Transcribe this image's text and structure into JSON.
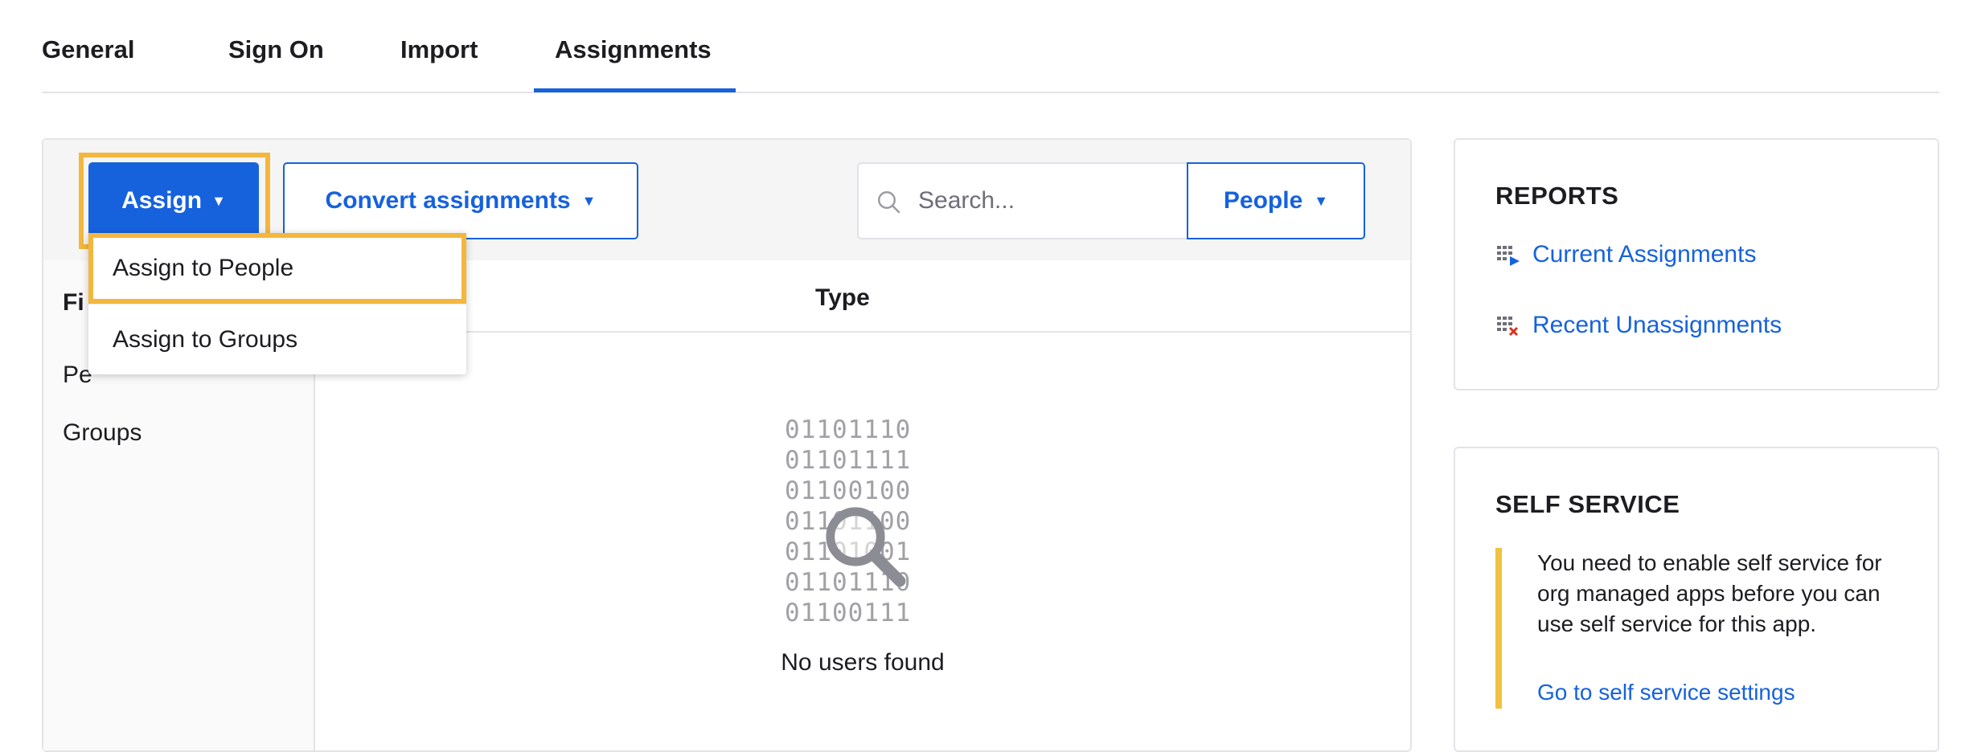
{
  "tabs": [
    {
      "label": "General"
    },
    {
      "label": "Sign On"
    },
    {
      "label": "Import"
    },
    {
      "label": "Assignments",
      "active": true
    }
  ],
  "toolbar": {
    "assign_label": "Assign",
    "convert_label": "Convert assignments",
    "search_placeholder": "Search...",
    "filter_select": "People",
    "caret": "▼"
  },
  "dropdown": {
    "items": [
      "Assign to People",
      "Assign to Groups"
    ]
  },
  "filters": {
    "header": "Fi",
    "items": [
      "Pe",
      "Groups"
    ]
  },
  "table": {
    "type_header": "Type",
    "binary_lines": [
      "01101110",
      "01101111",
      "01100100",
      "01101100",
      "01101001",
      "01101110",
      "01100111"
    ],
    "empty_message": "No users found"
  },
  "reports": {
    "title": "REPORTS",
    "links": [
      "Current Assignments",
      "Recent Unassignments"
    ]
  },
  "self_service": {
    "title": "SELF SERVICE",
    "notice": "You need to enable self service for org managed apps before you can use self service for this app.",
    "link": "Go to self service settings"
  },
  "colors": {
    "accent": "#1662dd",
    "highlight": "#f3b73d",
    "notice_bar": "#f0c23f"
  }
}
